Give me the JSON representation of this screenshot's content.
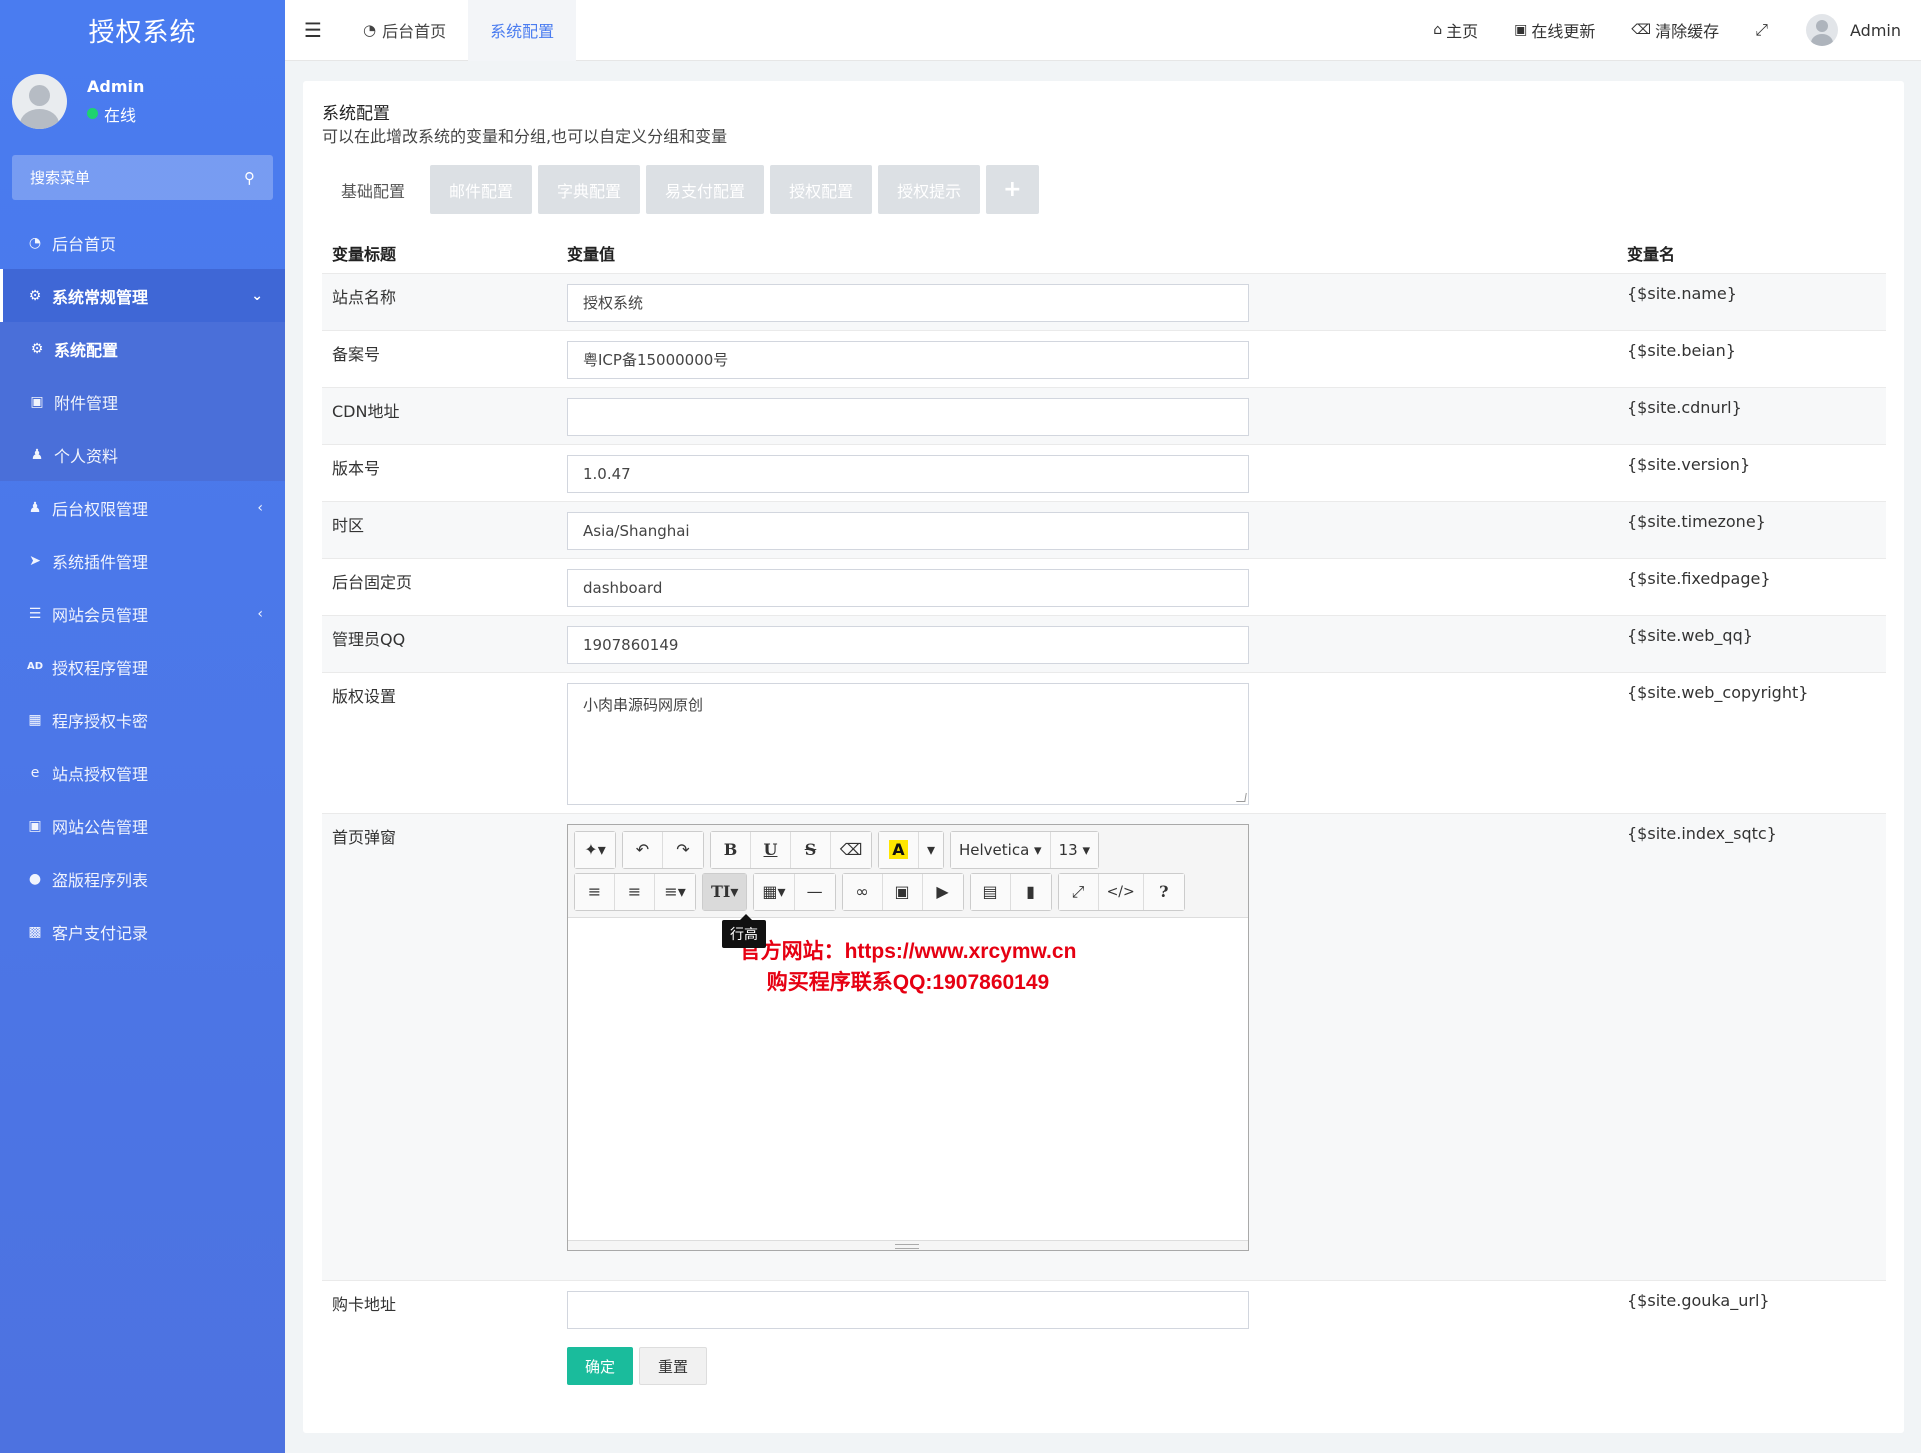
{
  "sidebar": {
    "brand": "授权系统",
    "user": {
      "name": "Admin",
      "status": "在线"
    },
    "search_placeholder": "搜索菜单",
    "items": [
      {
        "label": "后台首页",
        "icon": "dashboard-icon"
      },
      {
        "label": "系统常规管理",
        "icon": "cogs-icon"
      },
      {
        "label": "系统配置",
        "icon": "gear-icon"
      },
      {
        "label": "附件管理",
        "icon": "image-icon"
      },
      {
        "label": "个人资料",
        "icon": "user-icon"
      },
      {
        "label": "后台权限管理",
        "icon": "users-icon"
      },
      {
        "label": "系统插件管理",
        "icon": "rocket-icon"
      },
      {
        "label": "网站会员管理",
        "icon": "list-icon"
      },
      {
        "label": "授权程序管理",
        "icon": "ad-icon"
      },
      {
        "label": "程序授权卡密",
        "icon": "card-icon"
      },
      {
        "label": "站点授权管理",
        "icon": "ie-icon"
      },
      {
        "label": "网站公告管理",
        "icon": "notice-icon"
      },
      {
        "label": "盗版程序列表",
        "icon": "pirate-icon"
      },
      {
        "label": "客户支付记录",
        "icon": "payment-icon"
      }
    ]
  },
  "topbar": {
    "tabs": [
      {
        "label": "后台首页"
      },
      {
        "label": "系统配置"
      }
    ],
    "links": {
      "home": "主页",
      "update": "在线更新",
      "clear_cache": "清除缓存"
    },
    "user_name": "Admin"
  },
  "panel": {
    "title": "系统配置",
    "description": "可以在此增改系统的变量和分组,也可以自定义分组和变量",
    "tabs": [
      "基础配置",
      "邮件配置",
      "字典配置",
      "易支付配置",
      "授权配置",
      "授权提示"
    ],
    "columns": {
      "title": "变量标题",
      "value": "变量值",
      "name": "变量名"
    },
    "rows": [
      {
        "title": "站点名称",
        "value": "授权系统",
        "name": "{$site.name}"
      },
      {
        "title": "备案号",
        "value": "粤ICP备15000000号",
        "name": "{$site.beian}"
      },
      {
        "title": "CDN地址",
        "value": "",
        "name": "{$site.cdnurl}"
      },
      {
        "title": "版本号",
        "value": "1.0.47",
        "name": "{$site.version}"
      },
      {
        "title": "时区",
        "value": "Asia/Shanghai",
        "name": "{$site.timezone}"
      },
      {
        "title": "后台固定页",
        "value": "dashboard",
        "name": "{$site.fixedpage}"
      },
      {
        "title": "管理员QQ",
        "value": "1907860149",
        "name": "{$site.web_qq}"
      },
      {
        "title": "版权设置",
        "value": "小肉串源码网原创",
        "name": "{$site.web_copyright}"
      },
      {
        "title": "首页弹窗",
        "value": "",
        "name": "{$site.index_sqtc}"
      },
      {
        "title": "购卡地址",
        "value": "",
        "name": "{$site.gouka_url}"
      }
    ],
    "editor": {
      "font_name": "Helvetica",
      "font_size": "13",
      "tooltip": "行高",
      "content_line1": "官方网站：https://www.xrcymw.cn",
      "content_line2": "购买程序联系QQ:1907860149"
    },
    "buttons": {
      "submit": "确定",
      "reset": "重置"
    }
  }
}
